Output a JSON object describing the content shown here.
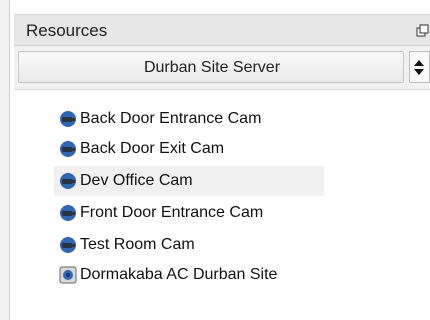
{
  "panel": {
    "title": "Resources",
    "float_icon": "float-window-icon"
  },
  "server": {
    "label": "Durban Site Server",
    "arrow_icon": "expand-arrow-icon"
  },
  "resources": [
    {
      "label": "Back Door Entrance Cam",
      "icon": "camera-icon",
      "selected": false
    },
    {
      "label": "Back Door Exit Cam",
      "icon": "camera-icon",
      "selected": false
    },
    {
      "label": "Dev Office Cam",
      "icon": "camera-icon",
      "selected": true
    },
    {
      "label": "Front Door Entrance Cam",
      "icon": "camera-icon",
      "selected": false
    },
    {
      "label": "Test Room Cam",
      "icon": "camera-icon",
      "selected": false
    },
    {
      "label": "Dormakaba AC Durban Site",
      "icon": "access-control-icon",
      "selected": false
    }
  ],
  "colors": {
    "header": "#e6e6e6",
    "server_row": "#f1f1f1",
    "selection": "#f0f0f0",
    "camera_blue": "#2f66b1",
    "camera_dark": "#2a3340"
  }
}
